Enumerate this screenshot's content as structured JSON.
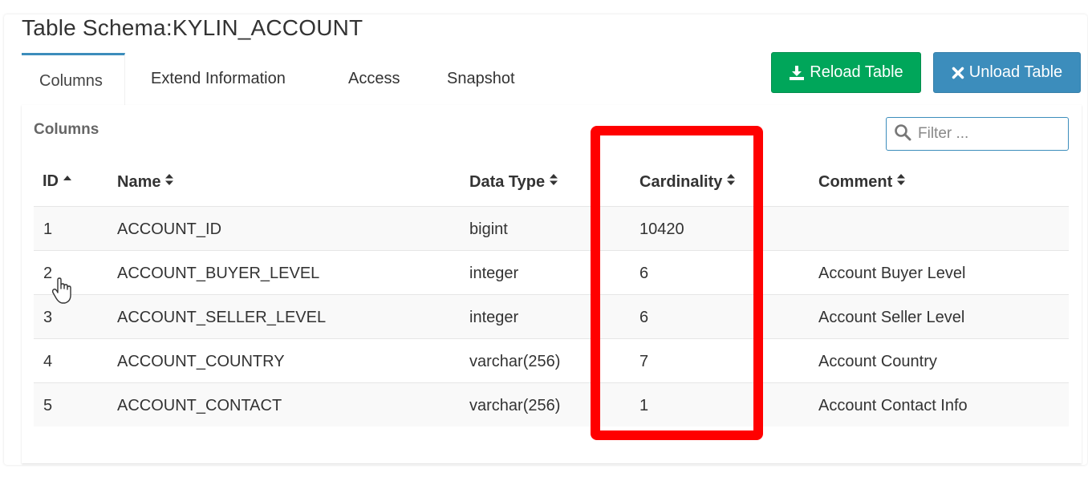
{
  "page": {
    "title": "Table Schema:KYLIN_ACCOUNT"
  },
  "tabs": [
    {
      "label": "Columns",
      "active": true
    },
    {
      "label": "Extend Information",
      "active": false
    },
    {
      "label": "Access",
      "active": false
    },
    {
      "label": "Snapshot",
      "active": false
    }
  ],
  "actions": {
    "reload_label": "Reload Table",
    "unload_label": "Unload Table",
    "reload_color": "#00a65a",
    "unload_color": "#3c8dbc"
  },
  "section": {
    "label": "Columns"
  },
  "filter": {
    "placeholder": "Filter ...",
    "value": ""
  },
  "table": {
    "headers": [
      "ID",
      "Name",
      "Data Type",
      "Cardinality",
      "Comment"
    ],
    "sort": {
      "column": "ID",
      "direction": "asc"
    },
    "rows": [
      {
        "id": "1",
        "name": "ACCOUNT_ID",
        "type": "bigint",
        "cardinality": "10420",
        "comment": ""
      },
      {
        "id": "2",
        "name": "ACCOUNT_BUYER_LEVEL",
        "type": "integer",
        "cardinality": "6",
        "comment": "Account Buyer Level"
      },
      {
        "id": "3",
        "name": "ACCOUNT_SELLER_LEVEL",
        "type": "integer",
        "cardinality": "6",
        "comment": "Account Seller Level"
      },
      {
        "id": "4",
        "name": "ACCOUNT_COUNTRY",
        "type": "varchar(256)",
        "cardinality": "7",
        "comment": "Account Country"
      },
      {
        "id": "5",
        "name": "ACCOUNT_CONTACT",
        "type": "varchar(256)",
        "cardinality": "1",
        "comment": "Account Contact Info"
      }
    ]
  },
  "annotation": {
    "color": "#ff0000",
    "target_column": "Cardinality"
  }
}
